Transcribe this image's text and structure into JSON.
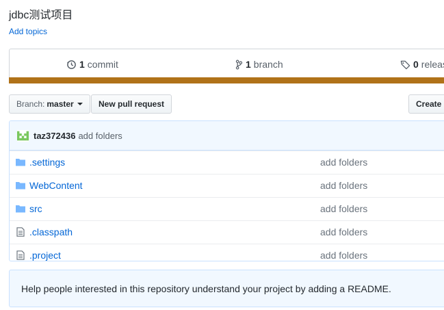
{
  "repo": {
    "description": "jdbc测试项目",
    "add_topics": "Add topics"
  },
  "summary": {
    "commits_count": "1",
    "commits_label": "commit",
    "branches_count": "1",
    "branches_label": "branch",
    "releases_count": "0",
    "releases_label": "releas",
    "language_color": "#b07219"
  },
  "toolbar": {
    "branch_prefix": "Branch:",
    "branch_name": "master",
    "new_pull_request": "New pull request",
    "create_new": "Create n"
  },
  "latest_commit": {
    "author": "taz372436",
    "message": "add folders"
  },
  "files": [
    {
      "type": "folder-icon",
      "name": ".settings",
      "message": "add folders"
    },
    {
      "type": "folder-icon",
      "name": "WebContent",
      "message": "add folders"
    },
    {
      "type": "folder-icon",
      "name": "src",
      "message": "add folders"
    },
    {
      "type": "file-icon",
      "name": ".classpath",
      "message": "add folders"
    },
    {
      "type": "file-icon",
      "name": ".project",
      "message": "add folders"
    }
  ],
  "readme_prompt": "Help people interested in this repository understand your project by adding a README."
}
